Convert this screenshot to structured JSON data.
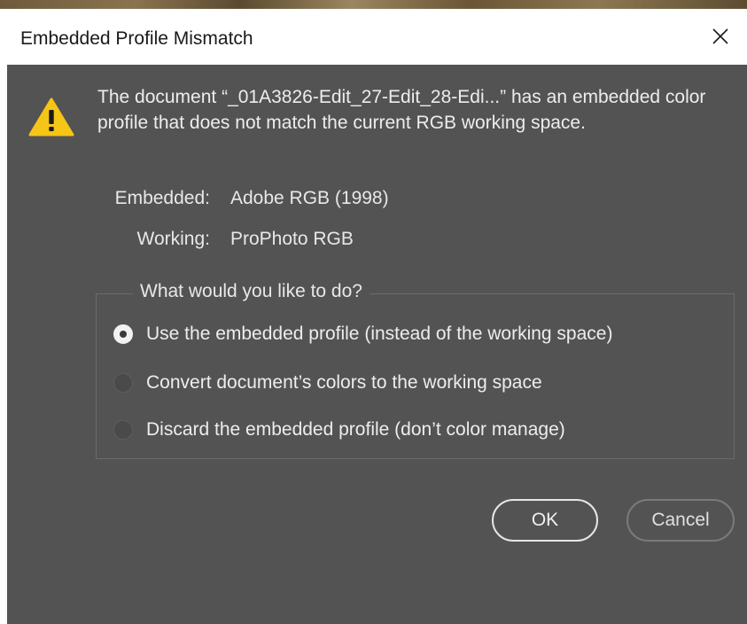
{
  "window": {
    "title": "Embedded Profile Mismatch",
    "close_icon": "close-icon"
  },
  "message": {
    "icon": "warning-icon",
    "text": "The document “_01A3826-Edit_27-Edit_28-Edi...” has an embedded color profile that does not match the current RGB working space."
  },
  "profiles": {
    "embedded_label": "Embedded:",
    "embedded_value": "Adobe RGB (1998)",
    "working_label": "Working:",
    "working_value": "ProPhoto RGB"
  },
  "options": {
    "legend": "What would you like to do?",
    "items": [
      {
        "label": "Use the embedded profile (instead of the working space)",
        "selected": true
      },
      {
        "label": "Convert document’s colors to the working space",
        "selected": false
      },
      {
        "label": "Discard the embedded profile (don’t color manage)",
        "selected": false
      }
    ]
  },
  "buttons": {
    "ok": "OK",
    "cancel": "Cancel"
  },
  "colors": {
    "dialog_bg": "#535353",
    "titlebar_bg": "#ffffff",
    "warning_yellow": "#f5c518"
  }
}
